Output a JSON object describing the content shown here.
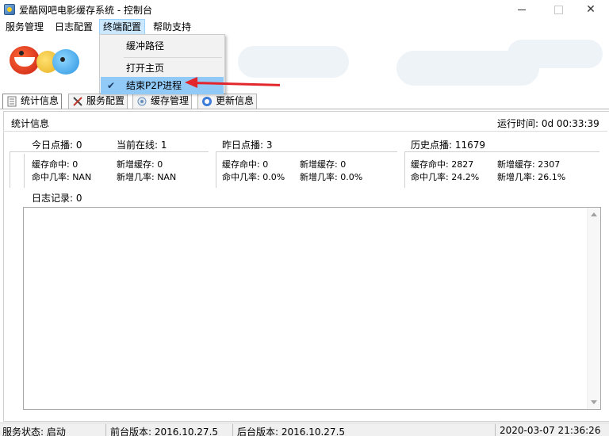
{
  "window": {
    "title": "爱酷网吧电影缓存系统 - 控制台"
  },
  "menubar": {
    "items": [
      {
        "label": "服务管理"
      },
      {
        "label": "日志配置"
      },
      {
        "label": "终端配置"
      },
      {
        "label": "帮助支持"
      }
    ]
  },
  "dropdown": {
    "items": [
      {
        "label": "缓冲路径",
        "checked": false
      },
      {
        "label": "打开主页",
        "checked": false
      },
      {
        "label": "结束P2P进程",
        "checked": true
      }
    ],
    "check_symbol": "✔"
  },
  "annotation": {
    "arrow_color": "#e3262b"
  },
  "tabs": [
    {
      "label": "统计信息",
      "icon": "document-icon",
      "active": true
    },
    {
      "label": "服务配置",
      "icon": "tools-icon",
      "active": false
    },
    {
      "label": "缓存管理",
      "icon": "cache-icon",
      "active": false
    },
    {
      "label": "更新信息",
      "icon": "update-icon",
      "active": false
    }
  ],
  "stats": {
    "panel_title": "统计信息",
    "runtime": "运行时间: 0d 00:33:39",
    "today": {
      "plays": "今日点播: 0",
      "online": "当前在线: 1",
      "cache_hit": "缓存命中: 0",
      "new_cache": "新增缓存: 0",
      "hit_rate": "命中几率: NAN",
      "new_rate": "新增几率: NAN"
    },
    "yesterday": {
      "plays": "昨日点播: 3",
      "cache_hit": "缓存命中: 0",
      "new_cache": "新增缓存: 0",
      "hit_rate": "命中几率: 0.0%",
      "new_rate": "新增几率: 0.0%"
    },
    "history": {
      "plays": "历史点播: 11679",
      "cache_hit": "缓存命中: 2827",
      "new_cache": "新增缓存: 2307",
      "hit_rate": "命中几率: 24.2%",
      "new_rate": "新增几率: 26.1%"
    },
    "log_label": "日志记录: 0"
  },
  "statusbar": {
    "service": "服务状态: 启动",
    "frontend": "前台版本: 2016.10.27.5",
    "backend": "后台版本: 2016.10.27.5",
    "datetime": "2020-03-07 21:36:26"
  }
}
